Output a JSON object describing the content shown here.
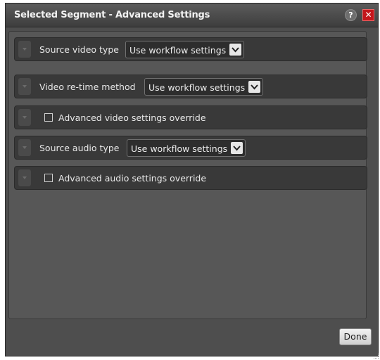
{
  "dialog": {
    "title": "Selected Segment - Advanced Settings",
    "help_label": "?",
    "close_label": "✕"
  },
  "rows": {
    "source_video_type": {
      "label": "Source video type",
      "value": "Use workflow settings"
    },
    "video_retime_method": {
      "label": "Video re-time method",
      "value": "Use workflow settings"
    },
    "advanced_video_override": {
      "label": "Advanced video settings override",
      "checked": false
    },
    "source_audio_type": {
      "label": "Source audio type",
      "value": "Use workflow settings"
    },
    "advanced_audio_override": {
      "label": "Advanced audio settings override",
      "checked": false
    }
  },
  "footer": {
    "done_label": "Done"
  },
  "icons": {
    "expand": "chevron-down-icon",
    "dropdown": "chevron-down-icon",
    "help": "question-icon",
    "close": "close-icon"
  },
  "colors": {
    "close_red": "#c4161c",
    "row_bg": "#393939",
    "dialog_bg": "#4e4e4e"
  }
}
